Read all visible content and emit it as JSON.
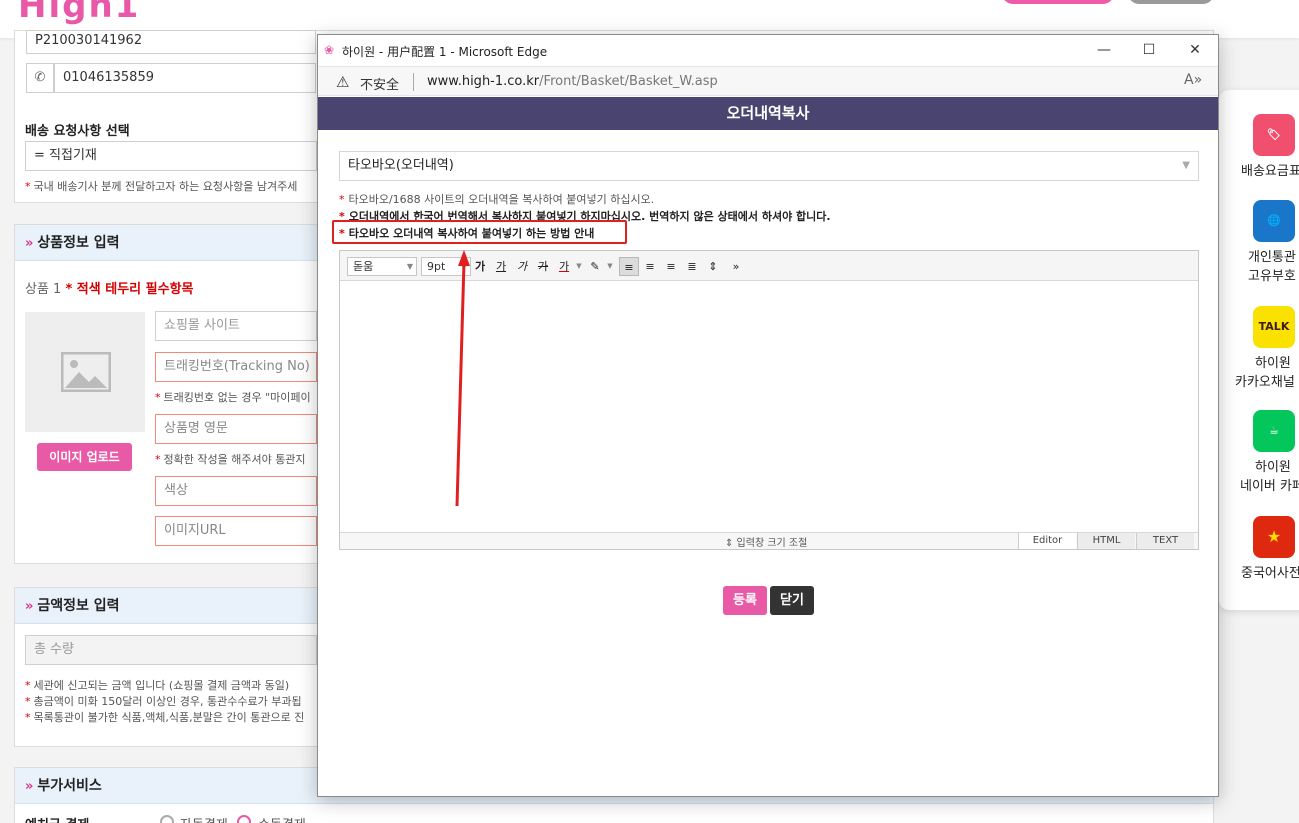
{
  "site": {
    "logo_text": "High1"
  },
  "shipping": {
    "customs_code": "P210030141962",
    "phone": "01046135859",
    "request_label": "배송 요청사항 선택",
    "request_value": "= 직접기재",
    "request_note": "국내 배송기사 분께 전달하고자 하는 요청사항을 남겨주세"
  },
  "product_section": {
    "title": "상품정보 입력",
    "item_label": "상품 1",
    "required_note": "* 적색 테두리 필수항목",
    "upload_button": "이미지 업로드",
    "shop_site_placeholder": "쇼핑몰 사이트",
    "tracking_placeholder": "트래킹번호(Tracking No)",
    "tracking_note": "트래킹번호 없는 경우 \"마이페이",
    "name_en_placeholder": "상품명 영문",
    "name_note": "정확한 작성을 해주셔야 통관지",
    "color_placeholder": "색상",
    "image_url_placeholder": "이미지URL"
  },
  "price_section": {
    "title": "금액정보 입력",
    "total_qty_placeholder": "총 수량",
    "notes": [
      "세관에 신고되는 금액 입니다 (쇼핑몰 결제 금액과 동일)",
      "총금액이 미화 150달러 이상인 경우, 통관수수료가 부과됩",
      "목록통관이 불가한 식품,액체,식품,분말은 간이 통관으로 진"
    ]
  },
  "extra_section": {
    "title": "부가서비스",
    "row_label": "예치금 결제",
    "option_auto": "자동결제",
    "option_manual": "수동결제"
  },
  "side_menu": [
    {
      "label1": "배송요금표",
      "label2": "",
      "color": "#f0506e",
      "icon": "tag-icon",
      "glyph": "🏷"
    },
    {
      "label1": "개인통관",
      "label2": "고유부호",
      "color": "#1a76c9",
      "icon": "globe-icon",
      "glyph": "🌐"
    },
    {
      "label1": "하이원",
      "label2": "카카오채널",
      "color": "#fae100",
      "icon": "kakao-talk-icon",
      "glyph": "TALK"
    },
    {
      "label1": "하이원",
      "label2": "네이버 카페",
      "color": "#03c75a",
      "icon": "cafe-icon",
      "glyph": "☕"
    },
    {
      "label1": "중국어사전",
      "label2": "",
      "color": "#de2910",
      "icon": "china-flag-icon",
      "glyph": "★"
    }
  ],
  "popup": {
    "window_title": "하이원 - 用户配置 1 - Microsoft Edge",
    "insecure_label": "不安全",
    "url_domain": "www.high-1.co.kr",
    "url_path": "/Front/Basket/Basket_W.asp",
    "header": "오더내역복사",
    "select_value": "타오바오(오더내역)",
    "notes": [
      "타오바오/1688 사이트의 오더내역을 복사하여 붙여넣기 하십시오.",
      "오더내역에서 한국어 번역해서 복사하지 붙여넣기 하지마십시오. 번역하지 않은 상태에서 하셔야 합니다.",
      "타오바오 오더내역 복사하여 붙여넣기 하는 방법 안내"
    ],
    "editor": {
      "font_value": "돋움",
      "size_value": "9pt",
      "resize_label": "⇕ 입력창 크기 조절",
      "tabs": [
        "Editor",
        "HTML",
        "TEXT"
      ]
    },
    "submit_label": "등록",
    "close_label": "닫기"
  }
}
